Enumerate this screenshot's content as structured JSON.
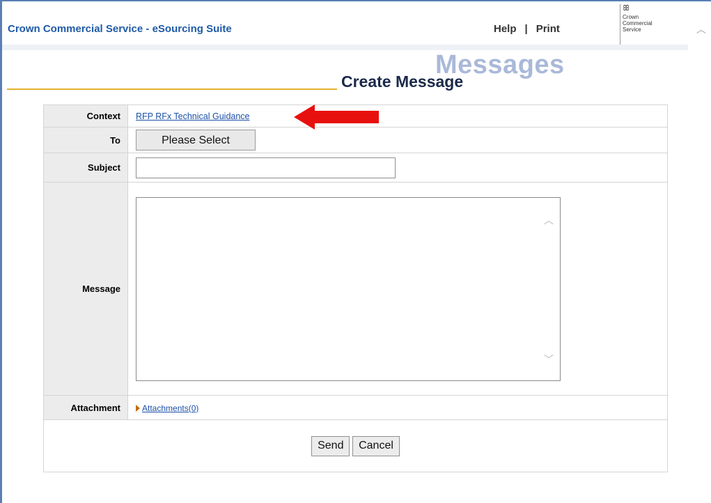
{
  "header": {
    "app_title": "Crown Commercial Service - eSourcing Suite",
    "help_label": "Help",
    "separator": "|",
    "print_label": "Print",
    "logo_crest": "ꕥ",
    "logo_lines": [
      "Crown",
      "Commercial",
      "Service"
    ]
  },
  "page": {
    "section_word": "Messages",
    "title": "Create Message"
  },
  "form": {
    "context_label": "Context",
    "context_link": "RFP RFx Technical Guidance",
    "to_label": "To",
    "to_button": "Please Select",
    "subject_label": "Subject",
    "subject_value": "",
    "message_label": "Message",
    "message_value": "",
    "attachment_label": "Attachment",
    "attachments_link": "Attachments(0)"
  },
  "actions": {
    "send_label": "Send",
    "cancel_label": "Cancel"
  },
  "annotation": {
    "arrow_color": "#e8100f"
  },
  "colors": {
    "brand_blue": "#1f5aa6",
    "title_underline": "#e6b230",
    "label_bg": "#ececec"
  }
}
